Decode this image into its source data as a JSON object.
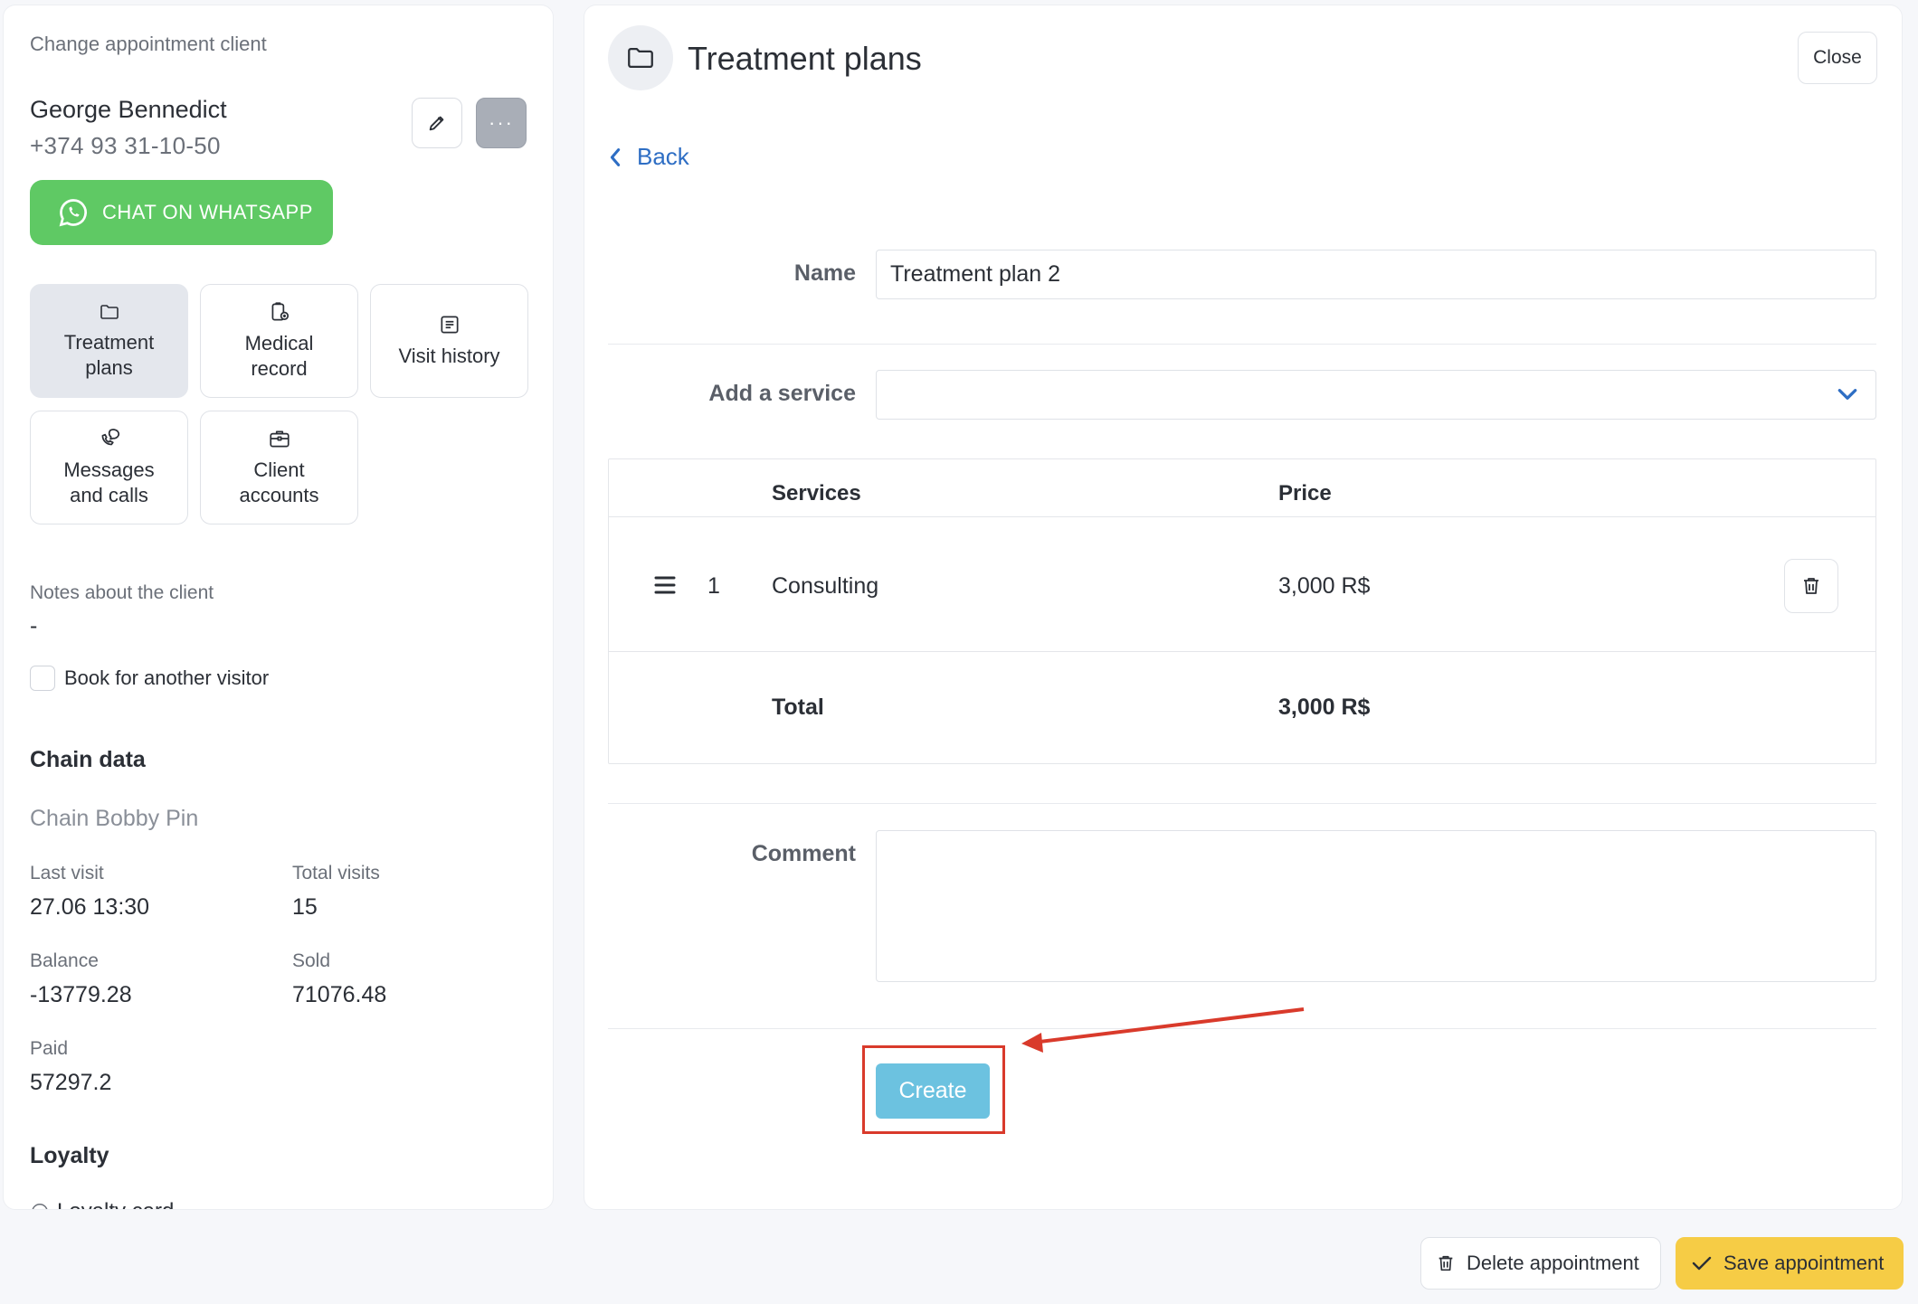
{
  "left_panel": {
    "title": "Change appointment client",
    "client": {
      "name": "George Bennedict",
      "phone": "+374 93 31-10-50"
    },
    "more_label": "···",
    "whatsapp_label": "CHAT ON WHATSAPP",
    "tiles": {
      "treatment": {
        "line1": "Treatment",
        "line2": "plans"
      },
      "medical": {
        "line1": "Medical",
        "line2": "record"
      },
      "visits": {
        "line1": "Visit history"
      },
      "messages": {
        "line1": "Messages",
        "line2": "and calls"
      },
      "accounts": {
        "line1": "Client",
        "line2": "accounts"
      }
    },
    "notes_label": "Notes about the client",
    "notes_value": "-",
    "book_other_label": "Book for another visitor",
    "chain": {
      "heading": "Chain data",
      "name": "Chain Bobby Pin",
      "last_visit_label": "Last visit",
      "last_visit": "27.06 13:30",
      "total_visits_label": "Total visits",
      "total_visits": "15",
      "balance_label": "Balance",
      "balance": "-13779.28",
      "sold_label": "Sold",
      "sold": "71076.48",
      "paid_label": "Paid",
      "paid": "57297.2"
    },
    "loyalty": {
      "heading": "Loyalty",
      "card_label": "Loyalty card"
    }
  },
  "right_panel": {
    "title": "Treatment plans",
    "close_label": "Close",
    "back_label": "Back",
    "form": {
      "name_label": "Name",
      "name_value": "Treatment plan 2",
      "service_label": "Add a service",
      "comment_label": "Comment",
      "create_label": "Create"
    },
    "table": {
      "headers": {
        "services": "Services",
        "price": "Price"
      },
      "rows": [
        {
          "num": "1",
          "service": "Consulting",
          "price": "3,000 R$"
        }
      ],
      "total_label": "Total",
      "total_value": "3,000 R$"
    }
  },
  "footer": {
    "delete_label": "Delete appointment",
    "save_label": "Save appointment"
  },
  "colors": {
    "whatsapp": "#5fc964",
    "link": "#2e6ec4",
    "create": "#6cc2e0",
    "save": "#f6cc45",
    "annotation": "#d93a2b"
  }
}
